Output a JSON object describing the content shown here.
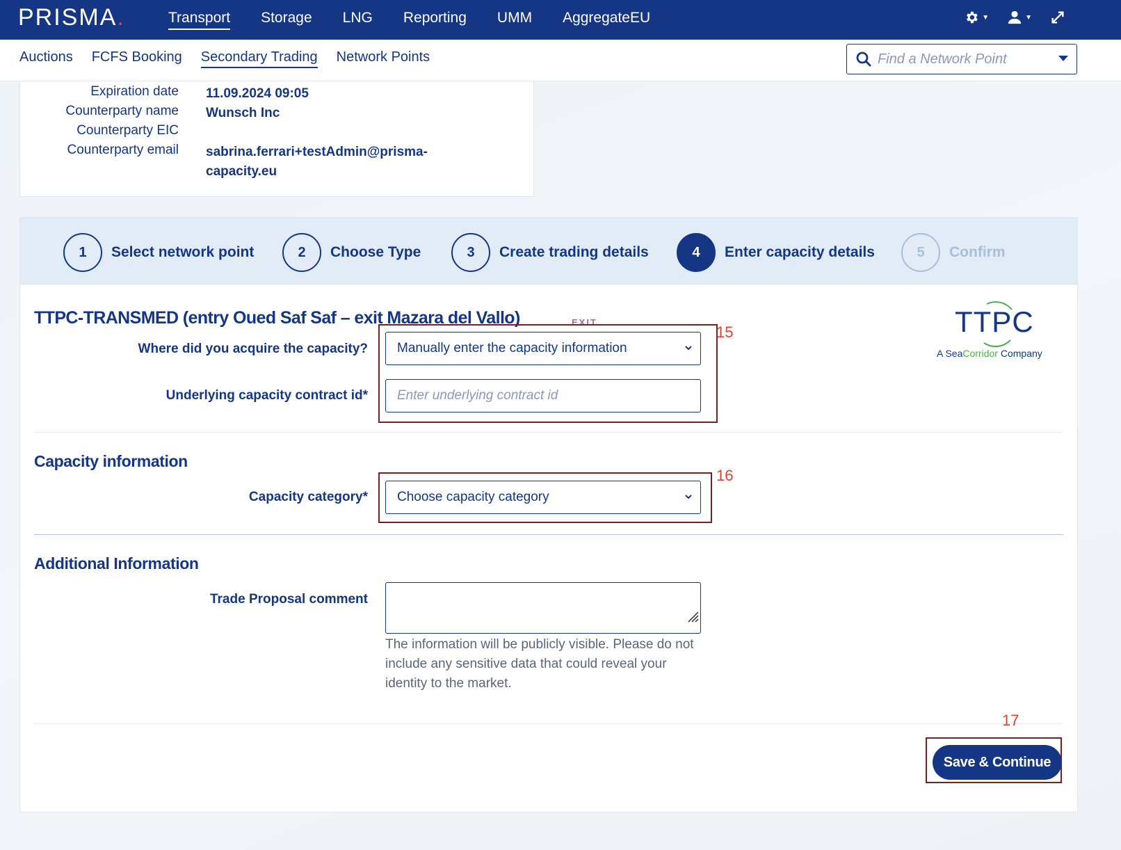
{
  "app": {
    "logo_text": "PRISMA",
    "logo_dot": ".",
    "top_nav": [
      "Transport",
      "Storage",
      "LNG",
      "Reporting",
      "UMM",
      "AggregateEU"
    ],
    "sub_nav": [
      "Auctions",
      "FCFS Booking",
      "Secondary Trading",
      "Network Points"
    ],
    "search_placeholder": "Find a Network Point",
    "icons": {
      "settings": "gear-icon",
      "user": "user-icon",
      "expand": "expand-icon",
      "search": "search-icon"
    }
  },
  "details": [
    {
      "label": "Expiration date",
      "value": "11.09.2024 09:05"
    },
    {
      "label": "Counterparty name",
      "value": "Wunsch Inc"
    },
    {
      "label": "Counterparty EIC",
      "value": ""
    },
    {
      "label": "Counterparty email",
      "value": "sabrina.ferrari+testAdmin@prisma-capacity.eu"
    }
  ],
  "stepper": [
    {
      "number": "1",
      "label": "Select network point",
      "state": "done"
    },
    {
      "number": "2",
      "label": "Choose Type",
      "state": "done"
    },
    {
      "number": "3",
      "label": "Create trading details",
      "state": "done"
    },
    {
      "number": "4",
      "label": "Enter capacity details",
      "state": "current"
    },
    {
      "number": "5",
      "label": "Confirm",
      "state": "disabled"
    }
  ],
  "form": {
    "point_title": "TTPC-TRANSMED (entry Oued Saf Saf – exit Mazara del Vallo)",
    "exit_tag": "EXIT",
    "operator_logo": {
      "main": "TTPC",
      "tag_prefix": "A Sea",
      "tag_green": "Corridor",
      "tag_suffix": " Company"
    },
    "acquire_label": "Where did you acquire the capacity?",
    "acquire_value": "Manually enter the capacity information",
    "contract_label": "Underlying capacity contract id*",
    "contract_placeholder": "Enter underlying contract id",
    "capacity_section": "Capacity information",
    "category_label": "Capacity category*",
    "category_value": "Choose capacity category",
    "additional_section": "Additional Information",
    "comment_label": "Trade Proposal comment",
    "comment_hint": "The information will be publicly visible. Please do not include any sensitive data that could reveal your identity to the market.",
    "save_label": "Save & Continue"
  },
  "annotations": [
    "15",
    "16",
    "17"
  ],
  "colors": {
    "brand": "#143684",
    "accent": "#e6397a",
    "highlight": "#7a1f1f",
    "annotation": "#e04431"
  }
}
